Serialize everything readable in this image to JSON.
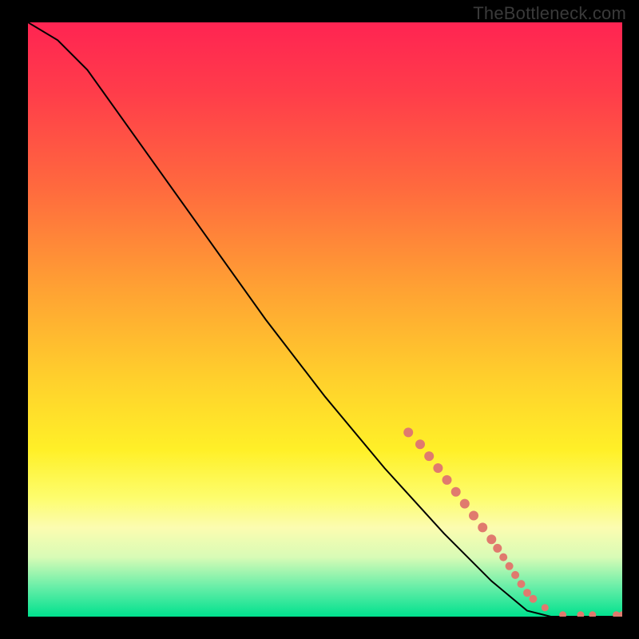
{
  "watermark": "TheBottleneck.com",
  "chart_data": {
    "type": "line",
    "title": "",
    "xlabel": "",
    "ylabel": "",
    "xlim": [
      0,
      100
    ],
    "ylim": [
      0,
      100
    ],
    "grid": false,
    "curve": [
      {
        "x": 0,
        "y": 100
      },
      {
        "x": 5,
        "y": 97
      },
      {
        "x": 10,
        "y": 92
      },
      {
        "x": 15,
        "y": 85
      },
      {
        "x": 20,
        "y": 78
      },
      {
        "x": 30,
        "y": 64
      },
      {
        "x": 40,
        "y": 50
      },
      {
        "x": 50,
        "y": 37
      },
      {
        "x": 60,
        "y": 25
      },
      {
        "x": 70,
        "y": 14
      },
      {
        "x": 78,
        "y": 6
      },
      {
        "x": 84,
        "y": 1
      },
      {
        "x": 88,
        "y": 0
      },
      {
        "x": 100,
        "y": 0
      }
    ],
    "markers": [
      {
        "x": 64,
        "y": 31,
        "r": 6
      },
      {
        "x": 66,
        "y": 29,
        "r": 6
      },
      {
        "x": 67.5,
        "y": 27,
        "r": 6
      },
      {
        "x": 69,
        "y": 25,
        "r": 6
      },
      {
        "x": 70.5,
        "y": 23,
        "r": 6
      },
      {
        "x": 72,
        "y": 21,
        "r": 6
      },
      {
        "x": 73.5,
        "y": 19,
        "r": 6
      },
      {
        "x": 75,
        "y": 17,
        "r": 6
      },
      {
        "x": 76.5,
        "y": 15,
        "r": 6
      },
      {
        "x": 78,
        "y": 13,
        "r": 6
      },
      {
        "x": 79,
        "y": 11.5,
        "r": 5.5
      },
      {
        "x": 80,
        "y": 10,
        "r": 5
      },
      {
        "x": 81,
        "y": 8.5,
        "r": 5
      },
      {
        "x": 82,
        "y": 7,
        "r": 5
      },
      {
        "x": 83,
        "y": 5.5,
        "r": 5
      },
      {
        "x": 84,
        "y": 4,
        "r": 5
      },
      {
        "x": 85,
        "y": 3,
        "r": 5
      },
      {
        "x": 87,
        "y": 1.5,
        "r": 4.5
      },
      {
        "x": 90,
        "y": 0.3,
        "r": 4.5
      },
      {
        "x": 93,
        "y": 0.3,
        "r": 4.5
      },
      {
        "x": 95,
        "y": 0.3,
        "r": 4.5
      },
      {
        "x": 99,
        "y": 0.3,
        "r": 4.5
      },
      {
        "x": 100,
        "y": 0.3,
        "r": 4.5
      }
    ],
    "marker_color": "#e07a6e",
    "background_gradient": {
      "top": "#ff2452",
      "mid": "#fff028",
      "bottom": "#00e18e"
    }
  }
}
